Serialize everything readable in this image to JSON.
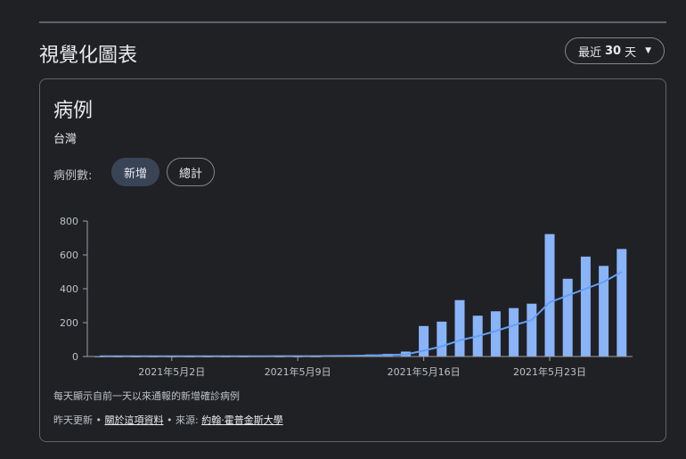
{
  "header": {
    "title": "視覺化圖表"
  },
  "range": {
    "prefix": "最近",
    "value": "30",
    "suffix": "天"
  },
  "card": {
    "title": "病例",
    "region": "台灣"
  },
  "metric": {
    "label": "病例數:",
    "chips": [
      "新增",
      "總計"
    ]
  },
  "footer": {
    "note": "每天顯示自前一天以來通報的新增確診病例",
    "updated": "昨天更新 •",
    "about_link": "關於這項資料",
    "source_prefix": "• 來源:",
    "source_link": "約翰·霍普金斯大學"
  },
  "colors": {
    "bar": "#8ab4f8",
    "line": "#669df6",
    "axis": "#9aa0a6"
  },
  "chart_data": {
    "type": "bar",
    "ylim": [
      0,
      800
    ],
    "yticks": [
      0,
      200,
      400,
      600,
      800
    ],
    "dates": [
      "2021-04-28",
      "2021-04-29",
      "2021-04-30",
      "2021-05-01",
      "2021-05-02",
      "2021-05-03",
      "2021-05-04",
      "2021-05-05",
      "2021-05-06",
      "2021-05-07",
      "2021-05-08",
      "2021-05-09",
      "2021-05-10",
      "2021-05-11",
      "2021-05-12",
      "2021-05-13",
      "2021-05-14",
      "2021-05-15",
      "2021-05-16",
      "2021-05-17",
      "2021-05-18",
      "2021-05-19",
      "2021-05-20",
      "2021-05-21",
      "2021-05-22",
      "2021-05-23",
      "2021-05-24",
      "2021-05-25",
      "2021-05-26",
      "2021-05-27"
    ],
    "xtick_labels": [
      {
        "date": "2021-05-02",
        "label": "2021年5月2日"
      },
      {
        "date": "2021-05-09",
        "label": "2021年5月9日"
      },
      {
        "date": "2021-05-16",
        "label": "2021年5月16日"
      },
      {
        "date": "2021-05-23",
        "label": "2021年5月23日"
      }
    ],
    "series": [
      {
        "values": [
          1,
          1,
          1,
          1,
          1,
          1,
          1,
          1,
          1,
          5,
          1,
          1,
          1,
          5,
          7,
          12,
          16,
          29,
          180,
          206,
          333,
          241,
          267,
          286,
          312,
          723,
          459,
          590,
          535,
          635
        ]
      },
      {
        "values": [
          1,
          1,
          1,
          1,
          1,
          1,
          1,
          1,
          1,
          1,
          2,
          2,
          2,
          3,
          4,
          6,
          9,
          12,
          35,
          60,
          95,
          120,
          150,
          185,
          215,
          320,
          360,
          400,
          440,
          500
        ]
      }
    ]
  }
}
